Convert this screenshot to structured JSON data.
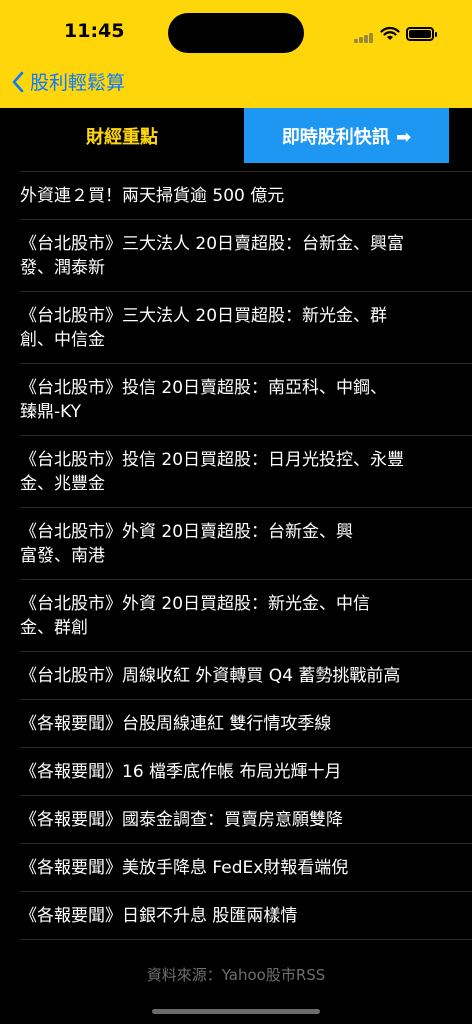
{
  "status": {
    "time": "11:45"
  },
  "nav": {
    "back_label": "股利輕鬆算"
  },
  "segments": {
    "left": "財經重點",
    "right": "即時股利快訊 ➡"
  },
  "news": [
    {
      "lines": [
        "外資連２買！兩天掃貨逾 500 億元"
      ]
    },
    {
      "lines": [
        "《台北股市》三大法人 20日賣超股：台新金、興富",
        "發、潤泰新"
      ]
    },
    {
      "lines": [
        "《台北股市》三大法人 20日買超股：新光金、群",
        "創、中信金"
      ]
    },
    {
      "lines": [
        "《台北股市》投信 20日賣超股：南亞科、中鋼、",
        "臻鼎-KY"
      ]
    },
    {
      "lines": [
        "《台北股市》投信 20日買超股：日月光投控、永豐",
        "金、兆豐金"
      ]
    },
    {
      "lines": [
        "《台北股市》外資 20日賣超股：台新金、興",
        "富發、南港"
      ]
    },
    {
      "lines": [
        "《台北股市》外資 20日買超股：新光金、中信",
        "金、群創"
      ]
    },
    {
      "lines": [
        "《台北股市》周線收紅 外資轉買 Q4 蓄勢挑戰前高"
      ]
    },
    {
      "lines": [
        "《各報要聞》台股周線連紅 雙行情攻季線"
      ]
    },
    {
      "lines": [
        "《各報要聞》16 檔季底作帳 布局光輝十月"
      ]
    },
    {
      "lines": [
        "《各報要聞》國泰金調查：買賣房意願雙降"
      ]
    },
    {
      "lines": [
        "《各報要聞》美放手降息 FedEx財報看端倪"
      ]
    },
    {
      "lines": [
        "《各報要聞》日銀不升息 股匯兩樣情"
      ]
    }
  ],
  "footer": {
    "source": "資料來源：Yahoo股市RSS"
  },
  "colors": {
    "header": "#FFD60A",
    "accent_blue": "#1e97f2",
    "link_blue": "#0A7AFF"
  },
  "icons": {
    "back": "chevron-left-icon",
    "wifi": "wifi-icon",
    "battery": "battery-icon",
    "signal": "cellular-signal-icon"
  }
}
